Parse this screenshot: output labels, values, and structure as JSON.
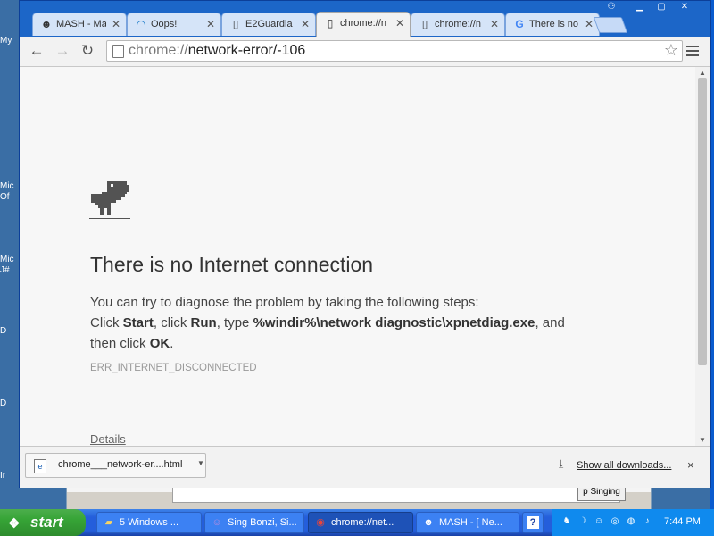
{
  "desktop": {
    "labels": [
      "My",
      "Mic",
      "Of",
      "Mic",
      "J#",
      "D",
      "D",
      "Ir"
    ],
    "bg_button": "p Singing"
  },
  "tabs": [
    {
      "icon": "mash-icon",
      "title": "MASH - Ma",
      "active": false
    },
    {
      "icon": "oops-icon",
      "title": "Oops!",
      "active": false
    },
    {
      "icon": "page-icon",
      "title": "E2Guardia",
      "active": false
    },
    {
      "icon": "page-icon",
      "title": "chrome://n",
      "active": true
    },
    {
      "icon": "page-icon",
      "title": "chrome://n",
      "active": false
    },
    {
      "icon": "google-icon",
      "title": "There is no",
      "active": false
    }
  ],
  "toolbar": {
    "url_scheme": "chrome://",
    "url_rest": "network-error/-106"
  },
  "error_page": {
    "headline": "There is no Internet connection",
    "intro": "You can try to diagnose the problem by taking the following steps:",
    "step_click": "Click ",
    "step_start": "Start",
    "step_mid1": ", click ",
    "step_run": "Run",
    "step_mid2": ", type ",
    "step_cmd": "%windir%\\network diagnostic\\xpnetdiag.exe",
    "step_mid3": ", and",
    "step_then": "then click ",
    "step_ok": "OK",
    "step_end": ".",
    "error_code": "ERR_INTERNET_DISCONNECTED",
    "details": "Details"
  },
  "download_shelf": {
    "filename": "chrome___network-er....html",
    "show_all": "Show all downloads...",
    "close": "×"
  },
  "taskbar": {
    "start": "start",
    "tasks": [
      {
        "icon": "folder-icon",
        "label": "5 Windows ...",
        "active": false
      },
      {
        "icon": "bonzi-icon",
        "label": "Sing Bonzi, Si...",
        "active": false
      },
      {
        "icon": "chrome-icon",
        "label": "chrome://net...",
        "active": true
      },
      {
        "icon": "mash-icon",
        "label": "MASH - [ Ne...",
        "active": false
      },
      {
        "icon": "help-icon",
        "label": "?",
        "active": false
      }
    ],
    "clock": "7:44 PM"
  }
}
